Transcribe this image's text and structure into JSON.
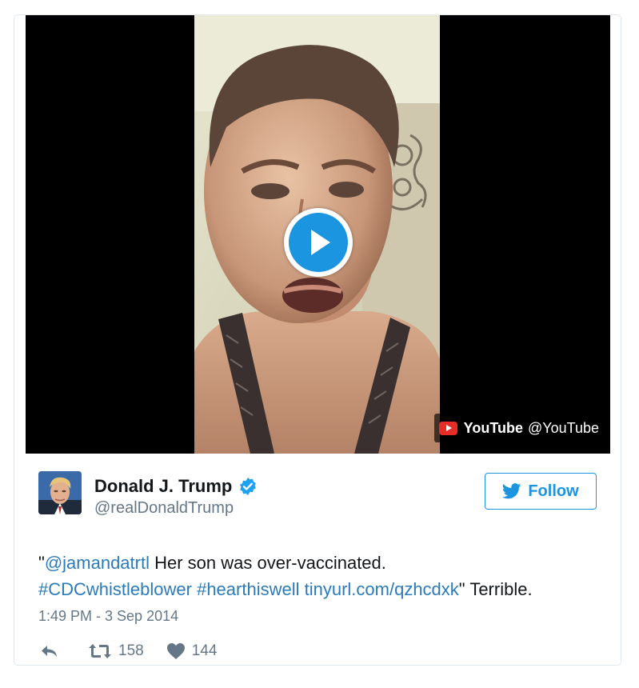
{
  "media": {
    "play_icon": "play-icon",
    "attribution": {
      "icon": "youtube-logo-icon",
      "brand": "YouTube",
      "handle": "@YouTube"
    }
  },
  "tweet": {
    "author": {
      "name": "Donald J. Trump",
      "handle": "@realDonaldTrump",
      "verified_icon": "verified-badge-icon"
    },
    "follow_button": {
      "icon": "twitter-bird-icon",
      "label": "Follow"
    },
    "text": {
      "open_quote": "\"",
      "mention": "@jamandatrtl",
      "body": " Her son was over-vaccinated. ",
      "hashtag_1": "#CDCwhistleblower",
      "space": " ",
      "hashtag_2": "#hearthiswell",
      "link": "tinyurl.com/qzhcdxk",
      "tail": "\" Terrible."
    },
    "timestamp": "1:49 PM - 3 Sep 2014",
    "actions": {
      "reply": {
        "icon": "reply-icon"
      },
      "retweet": {
        "icon": "retweet-icon",
        "count": "158"
      },
      "like": {
        "icon": "heart-icon",
        "count": "144"
      }
    }
  },
  "colors": {
    "accent": "#1b95e0",
    "link": "#2b7bb9",
    "muted": "#657786",
    "youtube_red": "#e52d27"
  }
}
